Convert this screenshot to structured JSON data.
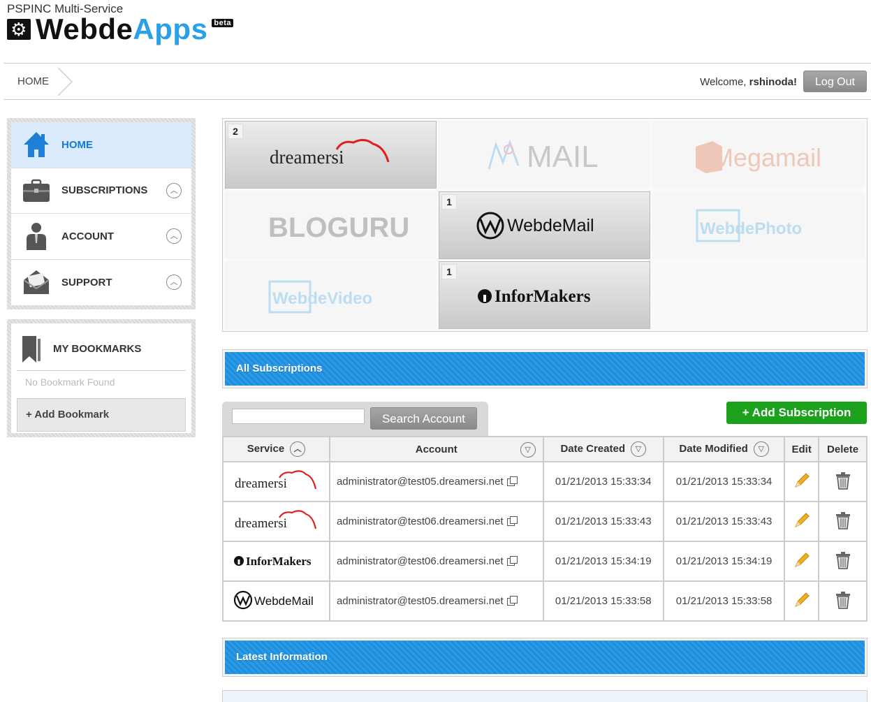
{
  "header": {
    "company": "PSPINC Multi-Service",
    "brand_part1": "Webde",
    "brand_part2": "Apps",
    "beta": "beta"
  },
  "topbar": {
    "breadcrumb": "HOME",
    "welcome_prefix": "Welcome,",
    "username": "rshinoda!",
    "logout_label": "Log Out"
  },
  "nav": {
    "items": [
      {
        "label": "HOME",
        "icon": "home-icon",
        "active": true
      },
      {
        "label": "SUBSCRIPTIONS",
        "icon": "briefcase-icon"
      },
      {
        "label": "ACCOUNT",
        "icon": "user-icon"
      },
      {
        "label": "SUPPORT",
        "icon": "support-envelope-icon"
      }
    ]
  },
  "bookmarks": {
    "title": "MY BOOKMARKS",
    "empty_text": "No Bookmark Found",
    "add_label": "Add Bookmark"
  },
  "services": {
    "tiles": [
      {
        "name": "dreamersi",
        "count": "2",
        "enabled": true
      },
      {
        "name": "MAIL",
        "enabled": false
      },
      {
        "name": "Megamail",
        "enabled": false
      },
      {
        "name": "BLOGURU",
        "enabled": false
      },
      {
        "name": "WebdeMail",
        "count": "1",
        "enabled": true
      },
      {
        "name": "WebdePhoto",
        "enabled": false
      },
      {
        "name": "WebdeVideo",
        "enabled": false
      },
      {
        "name": "InforMakers",
        "count": "1",
        "enabled": true
      }
    ]
  },
  "sections": {
    "all_subscriptions": "All Subscriptions",
    "latest_information": "Latest Information"
  },
  "search": {
    "value": "",
    "button_label": "Search Account"
  },
  "add_subscription_label": "Add Subscription",
  "table": {
    "headers": {
      "service": "Service",
      "account": "Account",
      "date_created": "Date Created",
      "date_modified": "Date Modified",
      "edit": "Edit",
      "delete": "Delete"
    },
    "rows": [
      {
        "service": "dreamersi",
        "account": "administrator@test05.dreamersi.net",
        "created": "01/21/2013 15:33:34",
        "modified": "01/21/2013 15:33:34"
      },
      {
        "service": "dreamersi",
        "account": "administrator@test06.dreamersi.net",
        "created": "01/21/2013 15:33:43",
        "modified": "01/21/2013 15:33:43"
      },
      {
        "service": "InforMakers",
        "account": "administrator@test06.dreamersi.net",
        "created": "01/21/2013 15:34:19",
        "modified": "01/21/2013 15:34:19"
      },
      {
        "service": "WebdeMail",
        "account": "administrator@test05.dreamersi.net",
        "created": "01/21/2013 15:33:58",
        "modified": "01/21/2013 15:33:58"
      }
    ]
  },
  "colors": {
    "accent_blue": "#1d8ddc",
    "add_green": "#1ca11c",
    "active_nav": "#d9ebfd"
  }
}
